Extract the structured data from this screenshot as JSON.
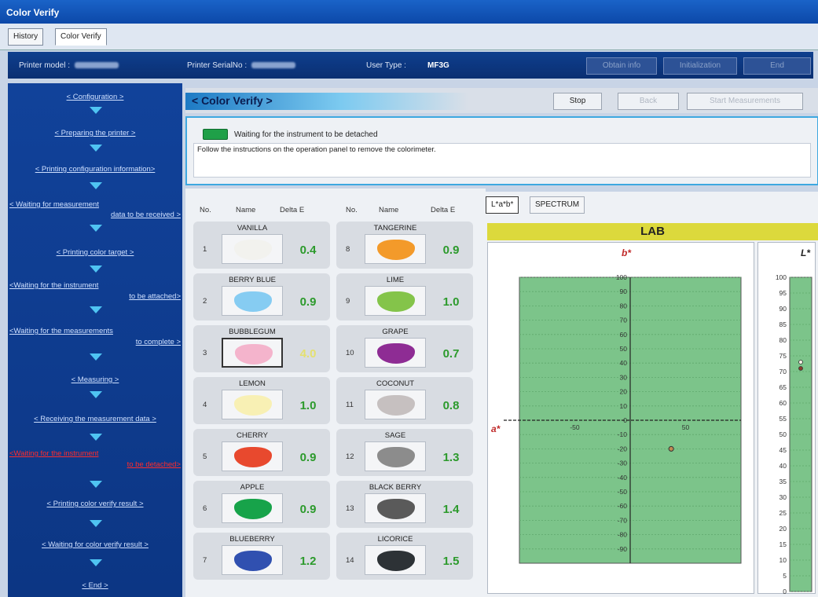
{
  "window": {
    "title": "Color Verify"
  },
  "tabs": [
    {
      "label": "History"
    },
    {
      "label": "Color Verify"
    }
  ],
  "infobar": {
    "printer_model_label": "Printer model :",
    "printer_serial_label": "Printer SerialNo :",
    "user_type_label": "User Type :",
    "user_type_value": "MF3G",
    "buttons": [
      "Obtain info",
      "Initialization",
      "End"
    ]
  },
  "steps": [
    {
      "label": "< Configuration >"
    },
    {
      "label": "< Preparing the printer >"
    },
    {
      "label": "< Printing configuration information>"
    },
    {
      "label": "< Waiting for measurement",
      "label2": "data to be received >"
    },
    {
      "label": "< Printing color target >"
    },
    {
      "label": "<Waiting for the instrument",
      "label2": "to be attached>"
    },
    {
      "label": "<Waiting for the measurements",
      "label2": "to complete >"
    },
    {
      "label": "< Measuring >"
    },
    {
      "label": "< Receiving the measurement data >"
    },
    {
      "label": "<Waiting for the instrument",
      "label2": "to be detached>"
    },
    {
      "label": "< Printing color verify result >"
    },
    {
      "label": "< Waiting for color verify result >"
    },
    {
      "label": "< End >"
    }
  ],
  "header": {
    "title": "< Color Verify >",
    "stop": "Stop",
    "back": "Back",
    "start": "Start Measurements"
  },
  "message": {
    "title": "Waiting for the instrument to be detached",
    "body": "Follow the instructions on the operation panel to remove the colorimeter.",
    "indicator_color": "#1fa048"
  },
  "table": {
    "headers": {
      "no": "No.",
      "name": "Name",
      "delta": "Delta E"
    },
    "items": [
      {
        "no": "1",
        "name": "VANILLA",
        "delta": "0.4",
        "color": "#f2f2ee"
      },
      {
        "no": "2",
        "name": "BERRY BLUE",
        "delta": "0.9",
        "color": "#86ccf2"
      },
      {
        "no": "3",
        "name": "BUBBLEGUM",
        "delta": "4.0",
        "color": "#f4b4cc",
        "selected": true,
        "delta_color": "#e4e070"
      },
      {
        "no": "4",
        "name": "LEMON",
        "delta": "1.0",
        "color": "#f8f0b4"
      },
      {
        "no": "5",
        "name": "CHERRY",
        "delta": "0.9",
        "color": "#e8492e"
      },
      {
        "no": "6",
        "name": "APPLE",
        "delta": "0.9",
        "color": "#17a34a"
      },
      {
        "no": "7",
        "name": "BLUEBERRY",
        "delta": "1.2",
        "color": "#3050b0"
      },
      {
        "no": "8",
        "name": "TANGERINE",
        "delta": "0.9",
        "color": "#f39a2a"
      },
      {
        "no": "9",
        "name": "LIME",
        "delta": "1.0",
        "color": "#84c44a"
      },
      {
        "no": "10",
        "name": "GRAPE",
        "delta": "0.7",
        "color": "#8e2c94"
      },
      {
        "no": "11",
        "name": "COCONUT",
        "delta": "0.8",
        "color": "#c6c0c0"
      },
      {
        "no": "12",
        "name": "SAGE",
        "delta": "1.3",
        "color": "#8c8c8c"
      },
      {
        "no": "13",
        "name": "BLACK BERRY",
        "delta": "1.4",
        "color": "#5a5a5a"
      },
      {
        "no": "14",
        "name": "LICORICE",
        "delta": "1.5",
        "color": "#2d3236"
      }
    ]
  },
  "chart": {
    "tabs": [
      "L*a*b*",
      "SPECTRUM"
    ],
    "title": "LAB",
    "b_axis_label": "b*",
    "a_axis_label": "a*",
    "l_axis_label": "L*",
    "plot_bg": "#7cc48a"
  },
  "chart_data": [
    {
      "type": "scatter",
      "title": "LAB",
      "xlabel": "a*",
      "ylabel": "b*",
      "xlim": [
        -100,
        100
      ],
      "ylim": [
        -100,
        100
      ],
      "xticks": [
        -50,
        0,
        50
      ],
      "yticks": [
        100,
        90,
        80,
        70,
        60,
        50,
        40,
        30,
        20,
        10,
        0,
        -10,
        -20,
        -30,
        -40,
        -50,
        -60,
        -70,
        -80,
        -90
      ],
      "points": [
        {
          "x": 37,
          "y": -20
        }
      ],
      "grid": true
    },
    {
      "type": "scatter",
      "ylabel": "L*",
      "ylim": [
        0,
        100
      ],
      "yticks": [
        100,
        95,
        90,
        85,
        80,
        75,
        70,
        65,
        60,
        55,
        50,
        45,
        40,
        35,
        30,
        25,
        20,
        15,
        10,
        5,
        0
      ],
      "points": [
        {
          "y": 73
        },
        {
          "y": 71
        }
      ],
      "grid": true
    }
  ]
}
